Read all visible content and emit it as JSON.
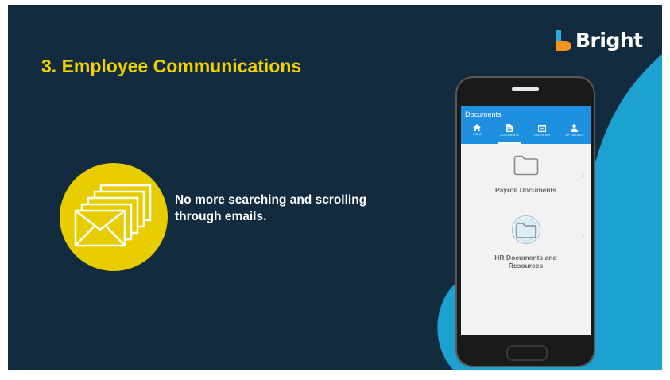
{
  "slide": {
    "title": "3. Employee Communications",
    "body_text": "No more searching and scrolling through emails."
  },
  "logo": {
    "name": "Bright"
  },
  "icons": {
    "envelope": "envelope-stack-icon",
    "folder": "folder-icon",
    "hr_folder": "hr-folder-icon"
  },
  "app": {
    "header_title": "Documents",
    "tabs": [
      {
        "label": "HOME",
        "icon": "home-icon",
        "active": false
      },
      {
        "label": "DOCUMENTS",
        "icon": "document-icon",
        "active": true
      },
      {
        "label": "CALENDAR",
        "icon": "calendar-icon",
        "active": false
      },
      {
        "label": "MY DETAILS",
        "icon": "person-icon",
        "active": false
      }
    ],
    "items": [
      {
        "label": "Payroll Documents"
      },
      {
        "label": "HR Documents and Resources"
      }
    ]
  },
  "colors": {
    "background": "#132b3f",
    "title": "#f1d200",
    "accent_circle": "#e7cd00",
    "blob": "#1da1d0",
    "app_header": "#1f8fe0",
    "logo_orange": "#f7941d",
    "logo_blue": "#29abe2"
  }
}
